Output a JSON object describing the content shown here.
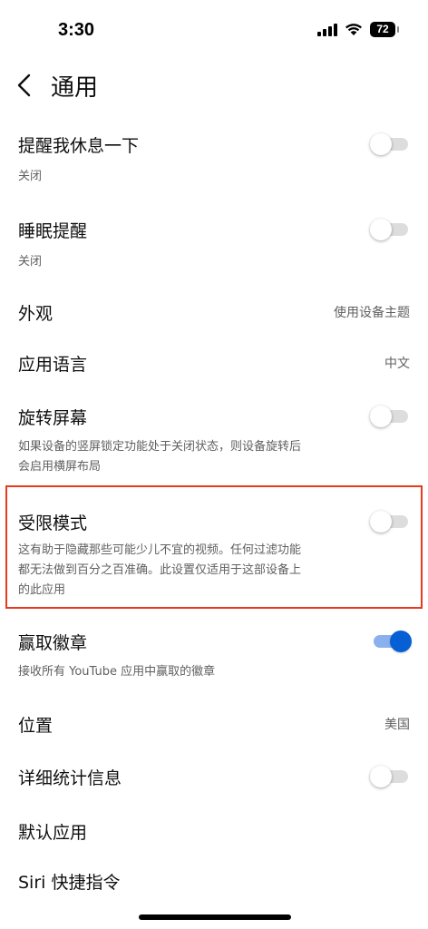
{
  "status_bar": {
    "time": "3:30",
    "battery": "72"
  },
  "header": {
    "title": "通用"
  },
  "settings": {
    "remind_break": {
      "title": "提醒我休息一下",
      "subtitle": "关闭"
    },
    "bedtime": {
      "title": "睡眠提醒",
      "subtitle": "关闭"
    },
    "appearance": {
      "title": "外观",
      "value": "使用设备主题"
    },
    "app_language": {
      "title": "应用语言",
      "value": "中文"
    },
    "rotate_screen": {
      "title": "旋转屏幕",
      "subtitle_line1": "如果设备的竖屏锁定功能处于关闭状态，则设备旋转后",
      "subtitle_line2": "会启用横屏布局"
    },
    "restricted_mode": {
      "title": "受限模式",
      "subtitle_line1": "这有助于隐藏那些可能少儿不宜的视频。任何过滤功能",
      "subtitle_line2": "都无法做到百分之百准确。此设置仅适用于这部设备上",
      "subtitle_line3": "的此应用"
    },
    "earn_badges": {
      "title": "赢取徽章",
      "subtitle": "接收所有 YouTube 应用中赢取的徽章"
    },
    "location": {
      "title": "位置",
      "value": "美国"
    },
    "stats_for_nerds": {
      "title": "详细统计信息"
    },
    "default_apps": {
      "title": "默认应用"
    },
    "siri_shortcuts": {
      "title": "Siri 快捷指令"
    }
  },
  "toggles": {
    "remind_break": false,
    "bedtime": false,
    "rotate_screen": false,
    "restricted_mode": false,
    "earn_badges": true,
    "stats_for_nerds": false
  },
  "colors": {
    "accent": "#065fd4",
    "highlight": "#e8391d"
  }
}
